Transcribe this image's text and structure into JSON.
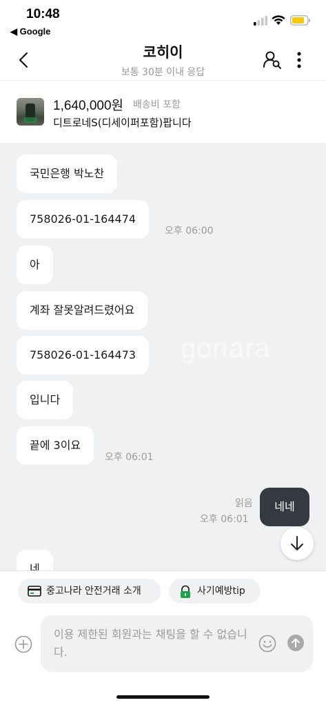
{
  "status_bar": {
    "time": "10:48",
    "back_app": "◀ Google"
  },
  "header": {
    "title": "코히이",
    "subtitle": "보통 30분 이내 응답"
  },
  "product": {
    "price": "1,640,000원",
    "shipping": "배송비 포함",
    "title": "디트로네S(디세이퍼포함)팝니다"
  },
  "chat": {
    "watermark": "gonara",
    "messages": [
      {
        "text": "국민은행 박노찬"
      },
      {
        "text": "758026-01-164474",
        "time": "오후 06:00"
      },
      {
        "text": "아"
      },
      {
        "text": "계좌 잘못알려드렸어요"
      },
      {
        "text": "758026-01-164473"
      },
      {
        "text": "입니다"
      },
      {
        "text": "끝에 3이요",
        "time": "오후 06:01"
      },
      {
        "text": "네"
      }
    ],
    "sent": {
      "text": "네네",
      "read": "읽음",
      "time": "오후 06:01"
    }
  },
  "quick_actions": [
    {
      "label": "중고나라 안전거래 소개",
      "icon": "card-icon"
    },
    {
      "label": "사기예방tip",
      "icon": "lock-icon"
    }
  ],
  "input": {
    "placeholder": "이용 제한된 회원과는 채팅을 할 수 없습니다."
  },
  "colors": {
    "chat_bg": "#f0f1f3",
    "sent_bubble": "#343a40",
    "battery": "#f6c90e",
    "lock_green": "#1fa34a"
  }
}
